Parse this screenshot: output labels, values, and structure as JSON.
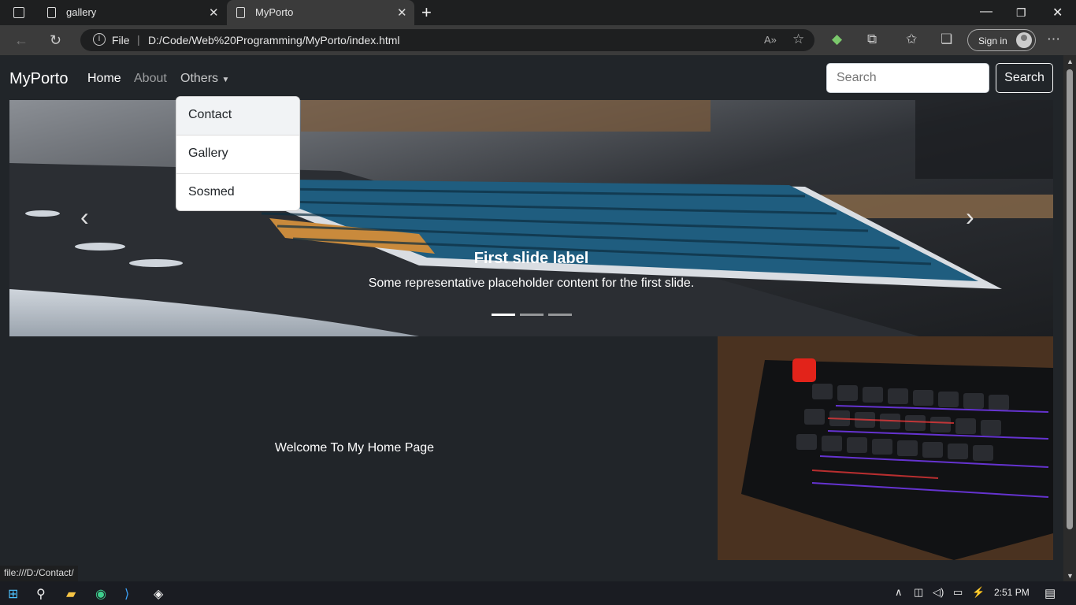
{
  "browser": {
    "tabs": [
      {
        "title": "gallery",
        "active": false
      },
      {
        "title": "MyPorto",
        "active": true
      }
    ],
    "url_scheme": "File",
    "url": "D:/Code/Web%20Programming/MyPorto/index.html",
    "signin_label": "Sign in",
    "status_url": "file:///D:/Contact/"
  },
  "navbar": {
    "brand": "MyPorto",
    "links": [
      "Home",
      "About",
      "Others"
    ],
    "search_placeholder": "Search",
    "search_button": "Search"
  },
  "dropdown": {
    "items": [
      "Contact",
      "Gallery",
      "Sosmed"
    ]
  },
  "carousel": {
    "title": "First slide label",
    "text": "Some representative placeholder content for the first slide.",
    "indicators": 3,
    "active_index": 0
  },
  "main": {
    "welcome": "Welcome To My Home Page"
  },
  "taskbar": {
    "time": "2:51 PM"
  }
}
